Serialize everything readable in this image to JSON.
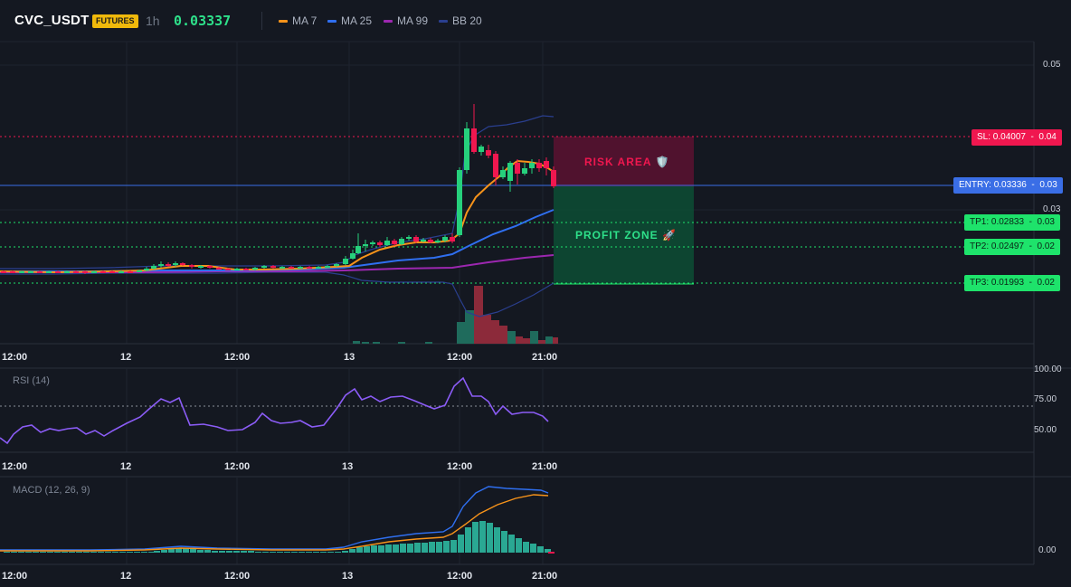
{
  "header": {
    "pair": "CVC_USDT",
    "badge": "FUTURES",
    "timeframe": "1h",
    "price": "0.03337",
    "indicators": [
      {
        "label": "MA 7",
        "color": "#f7931a"
      },
      {
        "label": "MA 25",
        "color": "#2f6ff0"
      },
      {
        "label": "MA 99",
        "color": "#9c27b0"
      },
      {
        "label": "BB 20",
        "color": "#2a3f8f"
      }
    ]
  },
  "levels": {
    "sl": "SL: 0.04007",
    "sl_axis": "0.04",
    "entry": "ENTRY: 0.03336",
    "entry_axis": "0.03",
    "tp1": "TP1: 0.02833",
    "tp1_axis": "0.03",
    "tp2": "TP2: 0.02497",
    "tp2_axis": "0.02",
    "tp3": "TP3: 0.01993",
    "tp3_axis": "0.02"
  },
  "zones": {
    "risk": "RISK AREA 🛡️",
    "profit": "PROFIT ZONE 🚀"
  },
  "price_axis": [
    "0.05",
    "0.03"
  ],
  "time_axis": [
    "12:00",
    "12",
    "12:00",
    "13",
    "12:00",
    "21:00"
  ],
  "rsi": {
    "title": "RSI (14)",
    "axis": [
      "100.00",
      "75.00",
      "50.00"
    ]
  },
  "macd": {
    "title": "MACD (12, 26, 9)",
    "axis": [
      "0.00"
    ]
  },
  "colors": {
    "up": "#26d07c",
    "down": "#f0174f",
    "background": "#141821"
  }
}
